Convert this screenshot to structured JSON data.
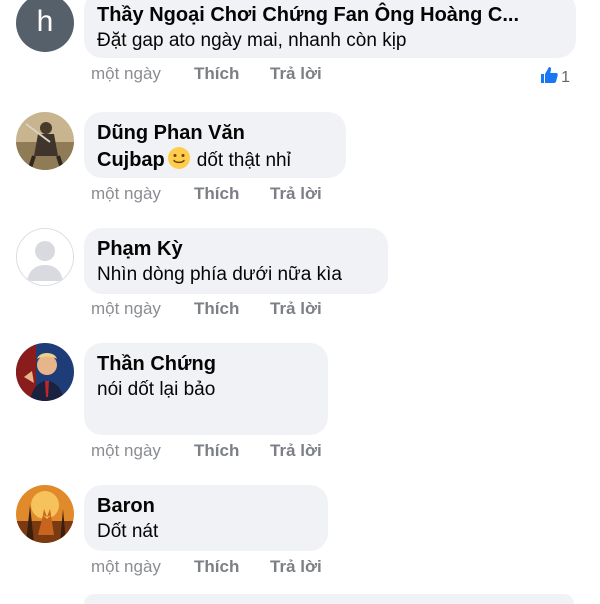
{
  "comments": [
    {
      "author": "Thầy Ngoại Chơi Chứng Fan Ông Hoàng C...",
      "text": "Đặt gap ato ngày mai, nhanh còn kịp",
      "avatar_letter": "h",
      "time": "một ngày",
      "like": "Thích",
      "reply": "Trả lời",
      "reaction_count": "1"
    },
    {
      "author_line1": "Dũng Phan Văn",
      "author_line2": "Cujbap",
      "text": "dốt thật nhỉ",
      "time": "một ngày",
      "like": "Thích",
      "reply": "Trả lời"
    },
    {
      "author": "Phạm Kỳ",
      "text": "Nhìn dòng phía dưới nữa kìa",
      "time": "một ngày",
      "like": "Thích",
      "reply": "Trả lời"
    },
    {
      "author": "Thần Chứng",
      "text": "nói dốt lại bảo",
      "time": "một ngày",
      "like": "Thích",
      "reply": "Trả lời"
    },
    {
      "author": "Baron",
      "text": "Dốt nát",
      "time": "một ngày",
      "like": "Thích",
      "reply": "Trả lời"
    }
  ],
  "colors": {
    "bubble": "#f0f2f5",
    "meta_text": "#8a8d91",
    "like_reaction": "#1877f2",
    "letter_avatar": "#56606a"
  },
  "icons": [
    "thumbs-up-reaction-icon",
    "slightly-smiling-face-emoji",
    "default-profile-silhouette-icon"
  ]
}
